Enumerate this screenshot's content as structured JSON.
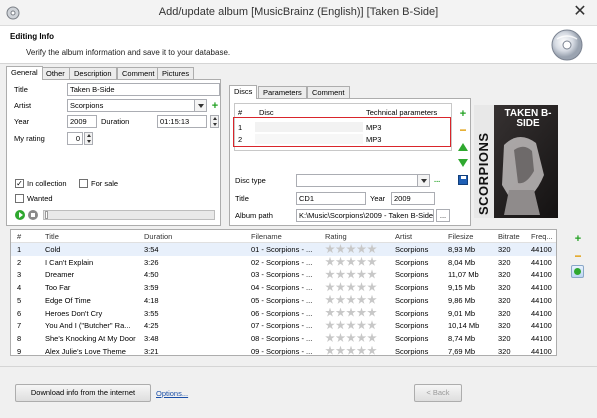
{
  "window": {
    "title": "Add/update album [MusicBrainz (English)] [Taken B-Side]",
    "close": "✕"
  },
  "header": {
    "title": "Editing Info",
    "subtitle": "Verify the album information and save it to your database."
  },
  "left_tabs": [
    "General",
    "Other",
    "Description",
    "Comment",
    "Pictures"
  ],
  "general": {
    "title_label": "Title",
    "title_value": "Taken B-Side",
    "artist_label": "Artist",
    "artist_value": "Scorpions",
    "year_label": "Year",
    "year_value": "2009",
    "duration_label": "Duration",
    "duration_value": "01:15:13",
    "rating_label": "My rating",
    "rating_value": "0",
    "in_collection_label": "In collection",
    "in_collection_checked": "✓",
    "for_sale_label": "For sale",
    "wanted_label": "Wanted"
  },
  "right_tabs": [
    "Discs",
    "Parameters",
    "Comment"
  ],
  "discs": {
    "headers": [
      "#",
      "Disc",
      "Technical parameters"
    ],
    "rows": [
      {
        "num": "1",
        "disc": "",
        "tech": "MP3"
      },
      {
        "num": "2",
        "disc": "",
        "tech": "MP3"
      }
    ],
    "disc_type_label": "Disc type",
    "disc_title_label": "Title",
    "disc_title_value": "CD1",
    "disc_year_label": "Year",
    "disc_year_value": "2009",
    "album_path_label": "Album path",
    "album_path_value": "K:\\Music\\Scorpions\\2009 - Taken B-Side\\",
    "browse": "...",
    "more": "..."
  },
  "cover": {
    "band": "SCORPIONS",
    "album": "TAKEN B-SIDE"
  },
  "tracks": {
    "headers": [
      "#",
      "Title",
      "Duration",
      "Filename",
      "Rating",
      "Artist",
      "Filesize",
      "Bitrate",
      "Freq..."
    ],
    "rows": [
      {
        "num": "1",
        "title": "Cold",
        "duration": "3:54",
        "filename": "01 - Scorpions - ...",
        "artist": "Scorpions",
        "size": "8,93 Mb",
        "bitrate": "320",
        "freq": "44100"
      },
      {
        "num": "2",
        "title": "I Can't Explain",
        "duration": "3:26",
        "filename": "02 - Scorpions - ...",
        "artist": "Scorpions",
        "size": "8,04 Mb",
        "bitrate": "320",
        "freq": "44100"
      },
      {
        "num": "3",
        "title": "Dreamer",
        "duration": "4:50",
        "filename": "03 - Scorpions - ...",
        "artist": "Scorpions",
        "size": "11,07 Mb",
        "bitrate": "320",
        "freq": "44100"
      },
      {
        "num": "4",
        "title": "Too Far",
        "duration": "3:59",
        "filename": "04 - Scorpions - ...",
        "artist": "Scorpions",
        "size": "9,15 Mb",
        "bitrate": "320",
        "freq": "44100"
      },
      {
        "num": "5",
        "title": "Edge Of Time",
        "duration": "4:18",
        "filename": "05 - Scorpions - ...",
        "artist": "Scorpions",
        "size": "9,86 Mb",
        "bitrate": "320",
        "freq": "44100"
      },
      {
        "num": "6",
        "title": "Heroes Don't Cry",
        "duration": "3:55",
        "filename": "06 - Scorpions - ...",
        "artist": "Scorpions",
        "size": "9,01 Mb",
        "bitrate": "320",
        "freq": "44100"
      },
      {
        "num": "7",
        "title": "You And I (\"Butcher\" Ra...",
        "duration": "4:25",
        "filename": "07 - Scorpions - ...",
        "artist": "Scorpions",
        "size": "10,14 Mb",
        "bitrate": "320",
        "freq": "44100"
      },
      {
        "num": "8",
        "title": "She's Knocking At My Door",
        "duration": "3:48",
        "filename": "08 - Scorpions - ...",
        "artist": "Scorpions",
        "size": "8,74 Mb",
        "bitrate": "320",
        "freq": "44100"
      },
      {
        "num": "9",
        "title": "Alex Julie's Love Theme",
        "duration": "3:21",
        "filename": "09 - Scorpions - ...",
        "artist": "Scorpions",
        "size": "7,69 Mb",
        "bitrate": "320",
        "freq": "44100"
      }
    ]
  },
  "footer": {
    "download_label": "Download info from the internet",
    "options_label": "Options...",
    "back_label": "< Back"
  },
  "colors": {
    "accent_red": "#d9252b",
    "green": "#21a121",
    "orange": "#e09a00"
  }
}
